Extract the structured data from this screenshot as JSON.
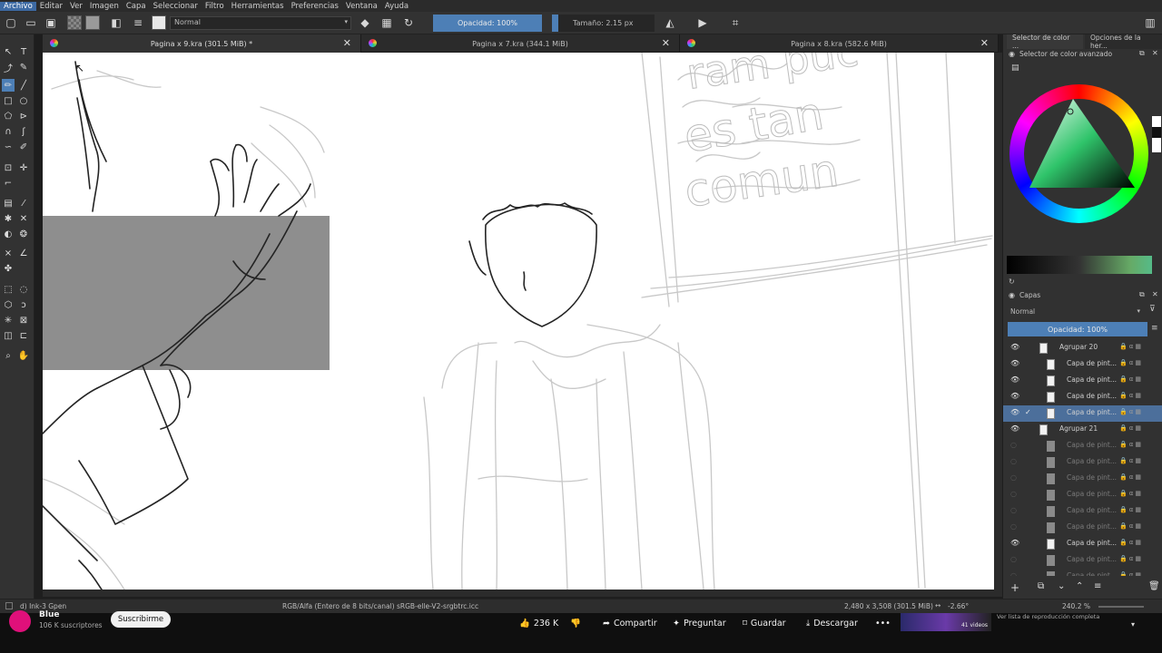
{
  "menu": [
    "Archivo",
    "Editar",
    "Ver",
    "Imagen",
    "Capa",
    "Seleccionar",
    "Filtro",
    "Herramientas",
    "Preferencias",
    "Ventana",
    "Ayuda"
  ],
  "toolbar": {
    "blend_mode": "Normal",
    "opacity_label": "Opacidad: 100%",
    "size_label": "Tamaño: 2.15 px"
  },
  "tabs": [
    {
      "title": "Pagina x 9.kra (301.5 MiB) *"
    },
    {
      "title": "Pagina x 7.kra (344.1 MiB)"
    },
    {
      "title": "Pagina x 8.kra (582.6 MiB)"
    }
  ],
  "dock": {
    "tab_color": "Selector de color ...",
    "tab_options": "Opciones de la her...",
    "color_panel_title": "Selector de color avanzado",
    "layers_panel_title": "Capas",
    "layers_blend": "Normal",
    "layers_opacity": "Opacidad:  100%",
    "layers": [
      {
        "name": "Agrupar 20",
        "visible": true,
        "selected": false,
        "group": true
      },
      {
        "name": "Capa de pint...",
        "visible": true,
        "selected": false,
        "group": false
      },
      {
        "name": "Capa de pint...",
        "visible": true,
        "selected": false,
        "group": false
      },
      {
        "name": "Capa de pint...",
        "visible": true,
        "selected": false,
        "group": false
      },
      {
        "name": "Capa de pint...",
        "visible": true,
        "selected": true,
        "group": false
      },
      {
        "name": "Agrupar 21",
        "visible": true,
        "selected": false,
        "group": true
      },
      {
        "name": "Capa de pint...",
        "visible": false,
        "selected": false,
        "group": false
      },
      {
        "name": "Capa de pint...",
        "visible": false,
        "selected": false,
        "group": false
      },
      {
        "name": "Capa de pint...",
        "visible": false,
        "selected": false,
        "group": false
      },
      {
        "name": "Capa de pint...",
        "visible": false,
        "selected": false,
        "group": false
      },
      {
        "name": "Capa de pint...",
        "visible": false,
        "selected": false,
        "group": false
      },
      {
        "name": "Capa de pint...",
        "visible": false,
        "selected": false,
        "group": false
      },
      {
        "name": "Capa de pint...",
        "visible": true,
        "selected": false,
        "group": false
      },
      {
        "name": "Capa de pint...",
        "visible": false,
        "selected": false,
        "group": false
      },
      {
        "name": "Capa de pint...",
        "visible": false,
        "selected": false,
        "group": false
      }
    ]
  },
  "status": {
    "brush": "d) Ink-3 Gpen",
    "color_space": "RGB/Alfa (Entero de 8 bits/canal)  sRGB-elle-V2-srgbtrc.icc",
    "dimensions": "2,480 x 3,508 (301.5 MiB)",
    "rotation": "-2.66°",
    "zoom": "240.2 %"
  },
  "youtube": {
    "channel": "Blue",
    "subscribers": "106 K suscriptores",
    "subscribe": "Suscribirme",
    "likes": "236 K",
    "share": "Compartir",
    "ask": "Preguntar",
    "save": "Guardar",
    "download": "Descargar",
    "playlist_text": "Ver lista de reproducción completa",
    "thumb_text": "41 videos"
  },
  "colors": {
    "accent": "#4d7fb6",
    "selected_layer": "#4c6f9b",
    "subscribe_bg": "#f1f1f1"
  }
}
